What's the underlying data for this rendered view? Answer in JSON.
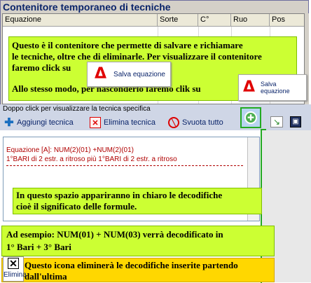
{
  "group": {
    "title": "Contenitore temporaneo di tecniche",
    "columns": [
      "Equazione",
      "Sorte",
      "C°",
      "Ruo",
      "Pos"
    ]
  },
  "note1": {
    "line1": "Questo è il contenitore che permette di salvare e richiamare",
    "line2": "le tecniche, oltre che di eliminarle. Per visualizzare il contenitore",
    "line3": "faremo click su",
    "line4": "Allo stesso modo, per nasconderlo  faremo clik su"
  },
  "salva1": {
    "label": "Salva equazione"
  },
  "salva2": {
    "label": "Salva equazione"
  },
  "hint": "Doppo click per visualizzare la tecnica specifica",
  "toolbar": {
    "add": "Aggiungi tecnica",
    "delete": "Elimina tecnica",
    "clear": "Svuota tutto"
  },
  "formula": {
    "line1": "Equazione [A]: NUM(2)(01) +NUM(2)(01)",
    "line2": "1°BARI  di 2 estr. a ritroso più  1°BARI  di 2 estr. a ritroso"
  },
  "note2": {
    "line1": "In questo spazio appariranno in chiaro le decodifiche",
    "line2": "cioè il significato delle formule."
  },
  "note3": {
    "line1": "Ad esempio: NUM(01) + NUM(03) verrà decodificato in",
    "line2": "1° Bari + 3° Bari"
  },
  "note4": {
    "line1": "Questo icona eliminerà le decodifiche inserite partendo",
    "line2": "dall'ultima"
  },
  "elimina_label": "Elimina",
  "colors": {
    "note_green": "#ccff33",
    "note_yellow": "#ffd700",
    "delta_red": "#e00000",
    "formula_red": "#b00000"
  }
}
